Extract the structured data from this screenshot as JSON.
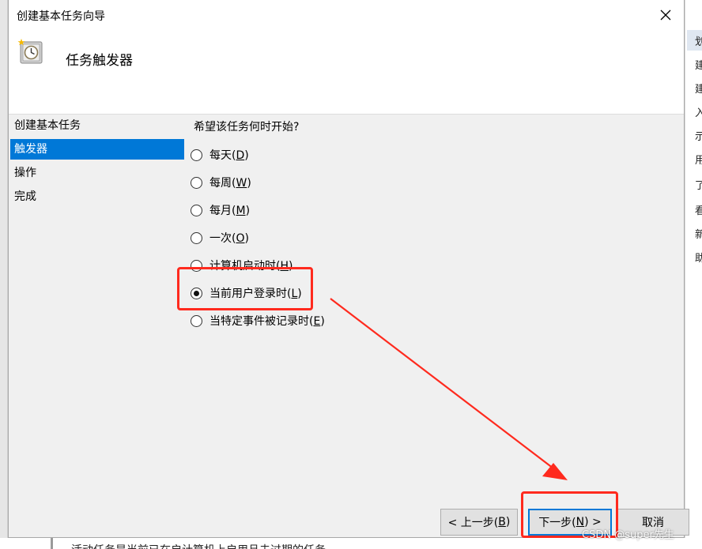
{
  "window": {
    "title": "创建基本任务向导"
  },
  "header": {
    "title": "任务触发器"
  },
  "nav": {
    "items": [
      {
        "label": "创建基本任务"
      },
      {
        "label": "触发器"
      },
      {
        "label": "操作"
      },
      {
        "label": "完成"
      }
    ]
  },
  "content": {
    "question": "希望该任务何时开始?",
    "options": [
      {
        "text": "每天(",
        "mnemonic": "D",
        "tail": ")",
        "checked": false
      },
      {
        "text": "每周(",
        "mnemonic": "W",
        "tail": ")",
        "checked": false
      },
      {
        "text": "每月(",
        "mnemonic": "M",
        "tail": ")",
        "checked": false
      },
      {
        "text": "一次(",
        "mnemonic": "O",
        "tail": ")",
        "checked": false
      },
      {
        "text": "计算机启动时(",
        "mnemonic": "H",
        "tail": ")",
        "checked": false
      },
      {
        "text": "当前用户登录时(",
        "mnemonic": "L",
        "tail": ")",
        "checked": true
      },
      {
        "text": "当特定事件被记录时(",
        "mnemonic": "E",
        "tail": ")",
        "checked": false
      }
    ]
  },
  "buttons": {
    "back": {
      "text": "< 上一步(",
      "mnemonic": "B",
      "tail": ")"
    },
    "next": {
      "text": "下一步(",
      "mnemonic": "N",
      "tail": ") >"
    },
    "cancel": {
      "text": "取消"
    }
  },
  "background": {
    "right_chars": [
      "划",
      "建",
      "建",
      "入",
      "示",
      "用",
      "了 用",
      "看",
      "新",
      "助"
    ],
    "bottom_text": "活动任务是当前已在启计算机上启用且未过期的任务"
  },
  "watermark": "CSDN @super先生",
  "colors": {
    "selection": "#0078d7",
    "annotation": "#ff2a1e",
    "dialog_bg": "#f0f0f0"
  },
  "icons": {
    "header": "clock-icon",
    "close": "close-icon"
  }
}
